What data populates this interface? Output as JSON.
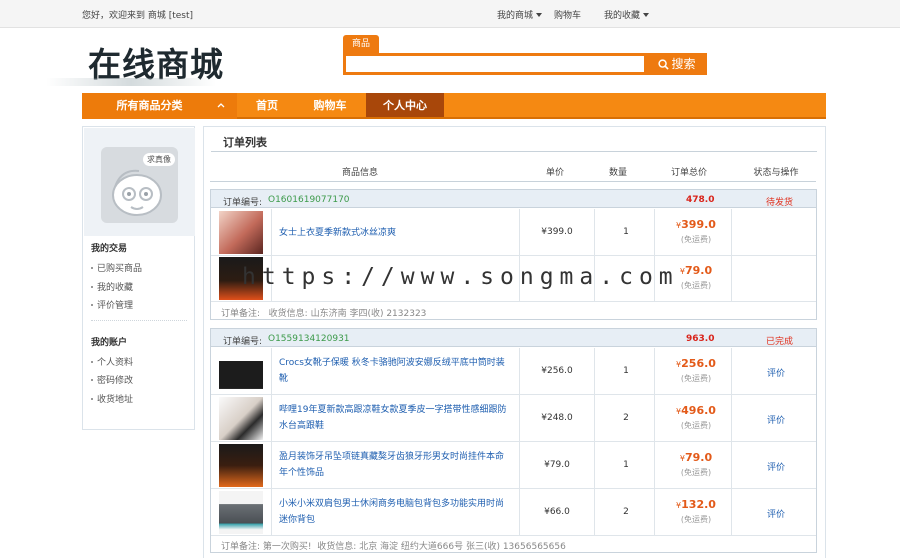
{
  "topbar": {
    "welcome": "您好，欢迎来到 商城 [test]",
    "my_mall": "我的商城",
    "cart": "购物车",
    "favorites": "我的收藏"
  },
  "header": {
    "logo_text": "在线商城",
    "search_tab": "商品",
    "search_value": "",
    "search_button": "搜索"
  },
  "nav": {
    "all_categories": "所有商品分类",
    "items": [
      "首页",
      "购物车",
      "个人中心"
    ],
    "active": "个人中心"
  },
  "sidebar": {
    "avatar_badge": "求真像",
    "section1": "我的交易",
    "section1_items": [
      "已购买商品",
      "我的收藏",
      "评价管理"
    ],
    "section2": "我的账户",
    "section2_items": [
      "个人资料",
      "密码修改",
      "收货地址"
    ]
  },
  "main": {
    "title": "订单列表",
    "columns": [
      "商品信息",
      "单价",
      "数量",
      "订单总价",
      "状态与操作"
    ],
    "order_no_label": "订单编号:",
    "note_label": "订单备注:",
    "addr_label": "收货信息:",
    "orders": [
      {
        "order_no": "O1601619077170",
        "total": "478.0",
        "status": "待发货",
        "items": [
          {
            "name": "女士上衣夏季新款式冰丝凉爽",
            "price": "¥399.0",
            "qty": "1",
            "total": "399.0",
            "shipping": "(免运费)"
          },
          {
            "name": "",
            "price": "",
            "qty": "",
            "total": "79.0",
            "shipping": "(免运费)"
          }
        ],
        "note": "",
        "address": "山东济南 李四(收) 2132323"
      },
      {
        "order_no": "O1559134120931",
        "total": "963.0",
        "status": "已完成",
        "items": [
          {
            "name": "Crocs女靴子保暖 秋冬卡骆驰阿波安娜反绒平底中筒时装靴",
            "price": "¥256.0",
            "qty": "1",
            "total": "256.0",
            "shipping": "(免运费)",
            "action": "评价"
          },
          {
            "name": "哔哩19年夏新款高跟凉鞋女款夏季皮一字搭带性感细跟防水台高跟鞋",
            "price": "¥248.0",
            "qty": "2",
            "total": "496.0",
            "shipping": "(免运费)",
            "action": "评价"
          },
          {
            "name": "盈月装饰牙吊坠项链真藏獒牙齿狼牙形男女时尚挂件本命年个性饰品",
            "price": "¥79.0",
            "qty": "1",
            "total": "79.0",
            "shipping": "(免运费)",
            "action": "评价"
          },
          {
            "name": "小米小米双肩包男士休闲商务电脑包背包多功能实用时尚迷你背包",
            "price": "¥66.0",
            "qty": "2",
            "total": "132.0",
            "shipping": "(免运费)",
            "action": "评价"
          }
        ],
        "note": "第一次购买!",
        "address": "北京 海淀 纽约大道666号 张三(收) 13656565656"
      }
    ]
  },
  "watermark": "https://www.songma.com"
}
